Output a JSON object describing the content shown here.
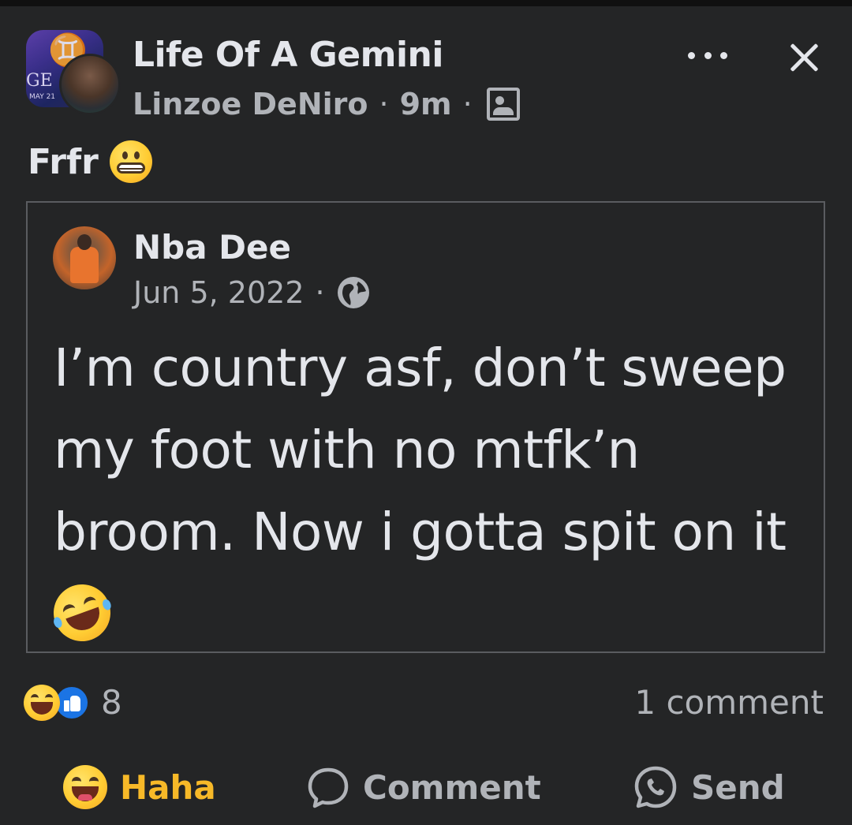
{
  "post": {
    "group_name": "Life Of A Gemini",
    "author": "Linzoe DeNiro",
    "time": "9m",
    "separator": "·",
    "avatar_text": {
      "ge": "GE",
      "may": "MAY 21",
      "glyph": "♊"
    },
    "caption": "Frfr"
  },
  "shared_post": {
    "author": "Nba Dee",
    "date": "Jun 5, 2022",
    "separator": "·",
    "text": "I’m country asf, don’t sweep my foot with no mtfk’n broom. Now i gotta spit on it"
  },
  "stats": {
    "reaction_count": "8",
    "comment_count": "1 comment"
  },
  "actions": {
    "haha_label": "Haha",
    "comment_label": "Comment",
    "send_label": "Send"
  },
  "icons": [
    "more-icon",
    "close-icon",
    "audience-friends-icon",
    "globe-icon",
    "haha-reaction-icon",
    "like-reaction-icon",
    "comment-icon",
    "messenger-send-icon",
    "grimace-emoji",
    "rofl-emoji"
  ],
  "colors": {
    "background": "#242526",
    "primary_text": "#e4e6eb",
    "secondary_text": "#b0b3b8",
    "haha_accent": "#f7b928",
    "like_blue": "#1b74e4",
    "quote_border": "#5a5c60"
  }
}
